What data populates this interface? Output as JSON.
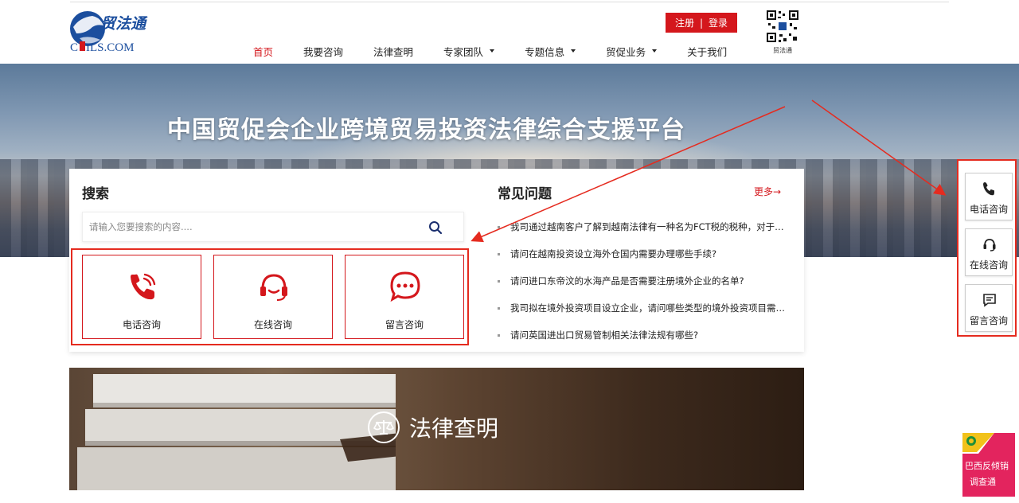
{
  "header": {
    "logo": {
      "cn": "贸法通",
      "en": "CCPIT-ILS.COM"
    },
    "nav": [
      {
        "label": "首页",
        "active": true,
        "dropdown": false
      },
      {
        "label": "我要咨询",
        "active": false,
        "dropdown": false
      },
      {
        "label": "法律查明",
        "active": false,
        "dropdown": false
      },
      {
        "label": "专家团队",
        "active": false,
        "dropdown": true
      },
      {
        "label": "专题信息",
        "active": false,
        "dropdown": true
      },
      {
        "label": "贸促业务",
        "active": false,
        "dropdown": true
      },
      {
        "label": "关于我们",
        "active": false,
        "dropdown": false
      }
    ],
    "register": "注册",
    "login": "登录",
    "separator": "|",
    "qr_label": "贸法通"
  },
  "hero": {
    "title": "中国贸促会企业跨境贸易投资法律综合支援平台"
  },
  "search": {
    "title": "搜索",
    "placeholder": "请输入您要搜索的内容....",
    "value": ""
  },
  "consult": {
    "phone": "电话咨询",
    "online": "在线咨询",
    "message": "留言咨询"
  },
  "faq": {
    "title": "常见问题",
    "more": "更多→",
    "items": [
      "我司通过越南客户了解到越南法律有一种名为FCT税的税种，对于在越南有收入的外国企业需要缴纳此税种，想了解该税种的具体内容",
      "请问在越南投资设立海外仓国内需要办理哪些手续?",
      "请问进口东帝汶的水海产品是否需要注册境外企业的名单?",
      "我司拟在境外投资项目设立企业，请问哪些类型的境外投资项目需要备案",
      "请问英国进出口贸易管制相关法律法规有哪些?"
    ]
  },
  "legal_banner": {
    "title": "法律查明"
  },
  "sidebar": {
    "phone": "电话咨询",
    "online": "在线咨询",
    "message": "留言咨询"
  },
  "promo": {
    "line1": "巴西反倾销",
    "line2": "调查通"
  },
  "colors": {
    "brand_red": "#d4171c",
    "annotation_red": "#e52b1f"
  },
  "icons": {
    "search": "search-icon",
    "phone": "phone-icon",
    "headset": "headset-icon",
    "chat": "chat-bubble-icon",
    "scales": "scales-icon"
  }
}
